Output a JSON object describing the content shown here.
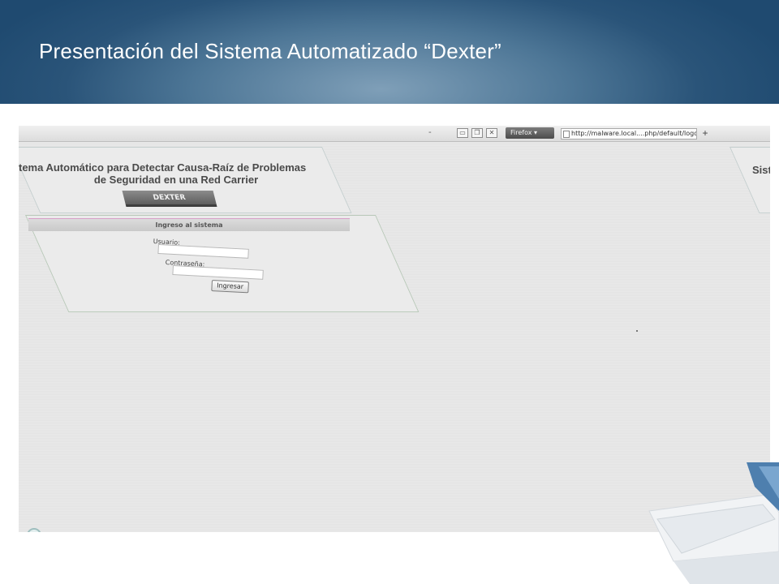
{
  "slide": {
    "title": "Presentación del Sistema Automatizado “Dexter”"
  },
  "browser": {
    "menu_dash": "-",
    "firefox_label": "Firefox ▾",
    "url": "http://malware.local....php/default/logout",
    "new_tab_symbol": "+"
  },
  "app": {
    "banner_line1": "tema Automático para Detectar Causa-Raíz de Problemas",
    "banner_line2": "de Seguridad en una Red Carrier",
    "logo_text": "DEXTER",
    "right_banner_text": "Siste",
    "login": {
      "header": "Ingreso al sistema",
      "user_label": "Usuario:",
      "password_label": "Contraseña:",
      "submit_label": "Ingresar",
      "user_value": "",
      "password_value": ""
    }
  },
  "colors": {
    "header_dark": "#1f4a70",
    "header_light": "#7f9fb8",
    "title_text": "#ffffff",
    "screenshot_bg": "#e8e8e8"
  }
}
